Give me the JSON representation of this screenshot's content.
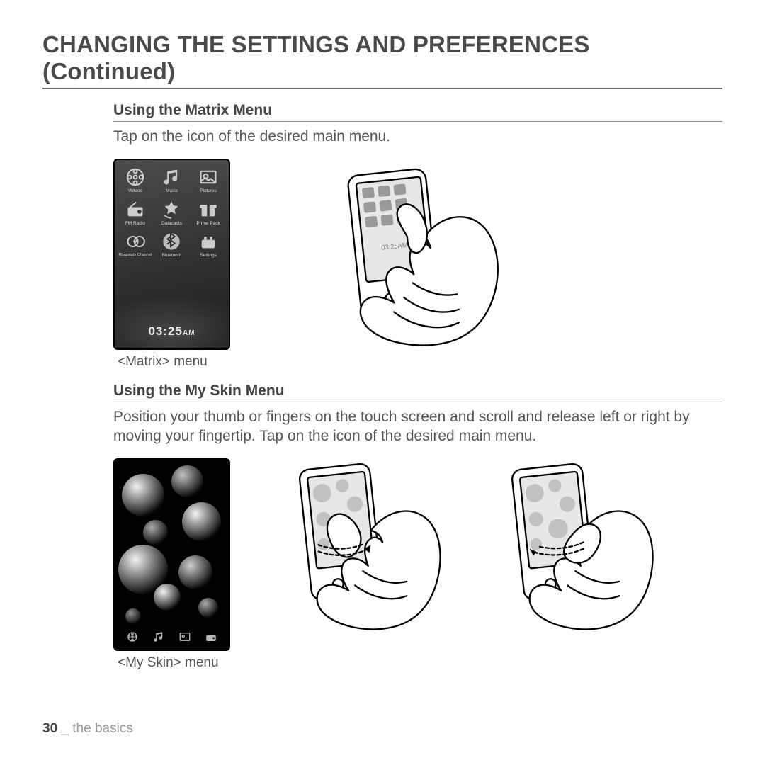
{
  "title": "CHANGING THE SETTINGS AND PREFERENCES (Continued)",
  "section1": {
    "heading": "Using the Matrix Menu",
    "body": "Tap on the icon of the desired main menu.",
    "caption": "<Matrix> menu",
    "time": "03:25",
    "ampm": "AM",
    "icons": [
      {
        "label": "Videos"
      },
      {
        "label": "Music"
      },
      {
        "label": "Pictures"
      },
      {
        "label": "FM Radio"
      },
      {
        "label": "Datacasts"
      },
      {
        "label": "Prime Pack"
      },
      {
        "label": "Rhapsody Channel"
      },
      {
        "label": "Bluetooth"
      },
      {
        "label": "Settings"
      }
    ]
  },
  "section2": {
    "heading": "Using the My Skin Menu",
    "body": "Position your thumb or fingers on the touch screen and scroll and release left or right by moving your fingertip. Tap on the icon of the desired main menu.",
    "caption": "<My Skin> menu"
  },
  "footer": {
    "page": "30",
    "sep": " _ ",
    "section": "the basics"
  }
}
